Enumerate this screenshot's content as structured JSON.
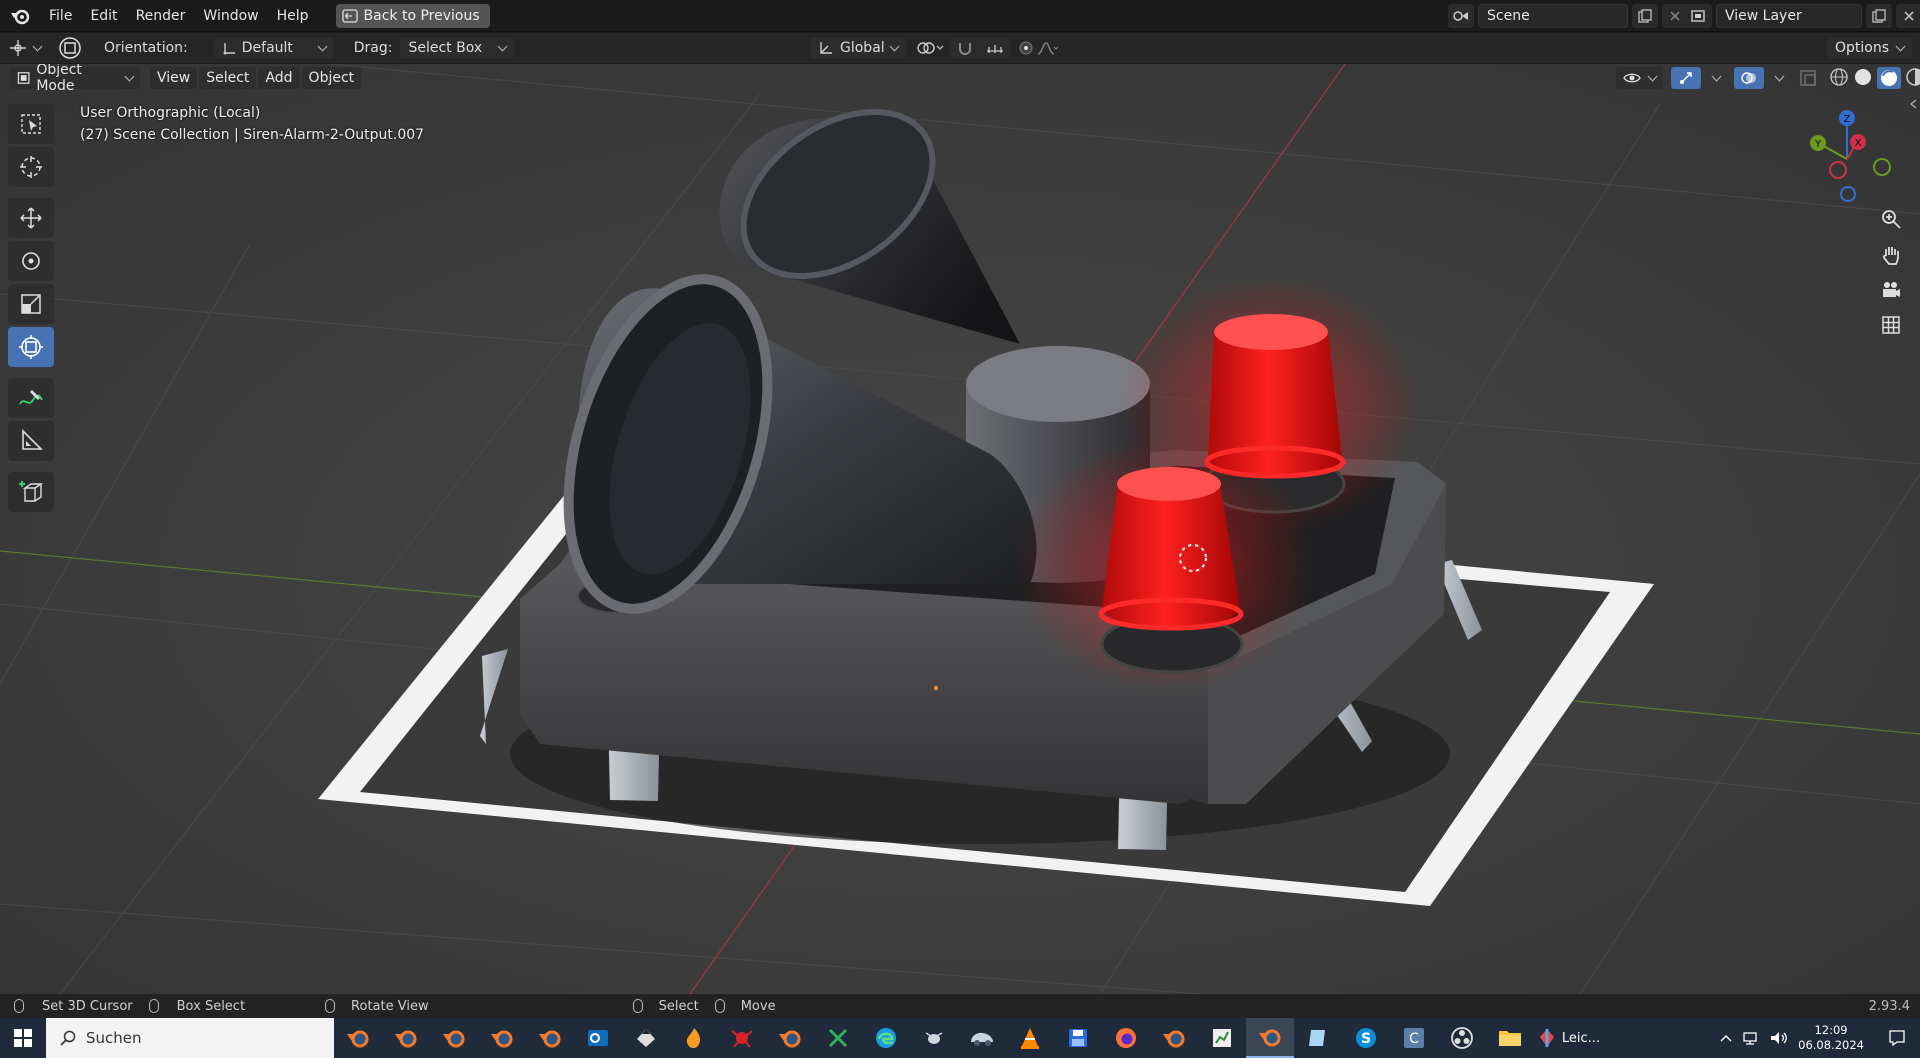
{
  "menubar": {
    "items": [
      "File",
      "Edit",
      "Render",
      "Window",
      "Help"
    ],
    "back_label": "Back to Previous",
    "scene_name": "Scene",
    "view_layer_name": "View Layer"
  },
  "tool_header": {
    "orientation_label": "Orientation:",
    "orientation_value": "Default",
    "drag_label": "Drag:",
    "drag_value": "Select Box",
    "transform_orientation": "Global",
    "options_label": "Options"
  },
  "viewport_header": {
    "mode": "Object Mode",
    "menus": [
      "View",
      "Select",
      "Add",
      "Object"
    ]
  },
  "viewport_overlay": {
    "view_name": "User Orthographic (Local)",
    "collection_info": "(27) Scene Collection | Siren-Alarm-2-Output.007"
  },
  "toolbar": {
    "tools": [
      "select-box-tool",
      "cursor-tool",
      "move-tool",
      "rotate-tool",
      "scale-tool",
      "transform-tool",
      "annotate-tool",
      "measure-tool",
      "add-cube-tool"
    ],
    "active": "transform-tool"
  },
  "gizmo": {
    "axes": [
      "Z",
      "Y",
      "X"
    ]
  },
  "statusbar": {
    "left_click": "Set 3D Cursor",
    "box_select": "Box Select",
    "rotate": "Rotate View",
    "select": "Select",
    "move": "Move",
    "version": "2.93.4"
  },
  "taskbar": {
    "search_placeholder": "Suchen",
    "app_label": "Leic...",
    "time": "12:09",
    "date": "06.08.2024"
  },
  "colors": {
    "accent": "#4772b3",
    "red_light": "#e01010",
    "axis_x": "#d0304a",
    "axis_y": "#6a9a1e",
    "axis_z": "#2f6fd3"
  }
}
